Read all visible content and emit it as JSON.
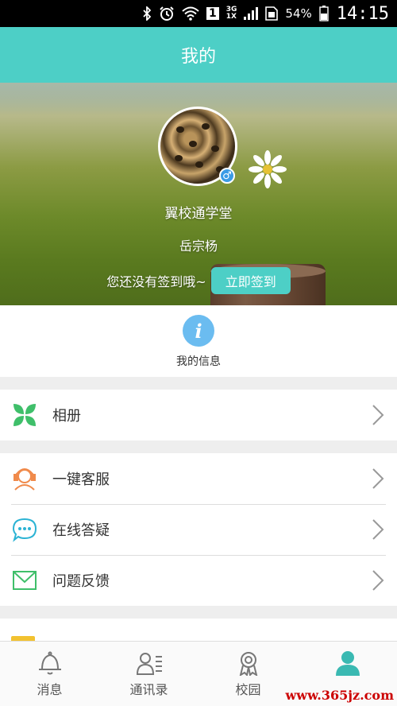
{
  "status_bar": {
    "battery": "54%",
    "time": "14:15",
    "network_top": "3G",
    "network_bottom": "1X",
    "sim_indicator": "1",
    "icons": [
      "bluetooth-icon",
      "alarm-icon",
      "wifi-icon",
      "signal-icon",
      "battery-icon"
    ]
  },
  "header": {
    "title": "我的"
  },
  "profile": {
    "school": "翼校通学堂",
    "name": "岳宗杨",
    "gender_symbol": "♂",
    "sign_hint": "您还没有签到哦~",
    "sign_button": "立即签到"
  },
  "info": {
    "icon_glyph": "i",
    "label": "我的信息"
  },
  "menu_groups": [
    [
      {
        "label": "相册",
        "icon": "album-icon"
      }
    ],
    [
      {
        "label": "一键客服",
        "icon": "customer-service-icon"
      },
      {
        "label": "在线答疑",
        "icon": "chat-bubble-icon"
      },
      {
        "label": "问题反馈",
        "icon": "mail-icon"
      }
    ]
  ],
  "tabs": [
    {
      "label": "消息",
      "icon": "bell-icon",
      "active": false
    },
    {
      "label": "通讯录",
      "icon": "contacts-icon",
      "active": false
    },
    {
      "label": "校园",
      "icon": "campus-icon",
      "active": false
    },
    {
      "label": "我的",
      "icon": "person-icon",
      "active": true
    }
  ],
  "watermark": "www.365jz.com",
  "colors": {
    "accent": "#4dcfc6",
    "info_blue": "#6bbcf0",
    "tab_active": "#3ab9b2"
  }
}
